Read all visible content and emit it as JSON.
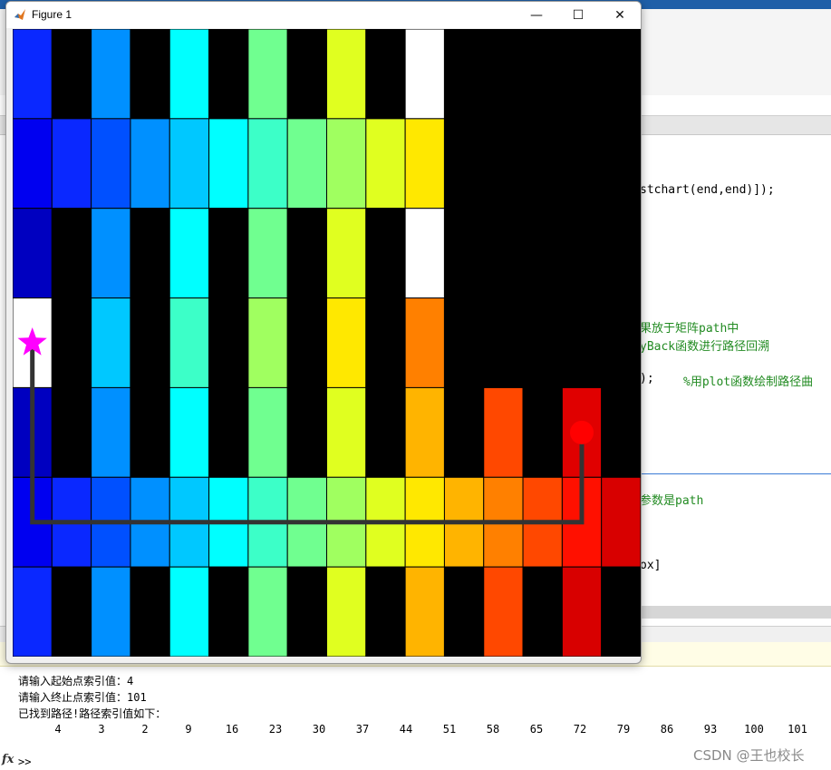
{
  "figure": {
    "title": "Figure 1",
    "controls": {
      "minimize": "—",
      "maximize": "☐",
      "close": "✕"
    }
  },
  "editor": {
    "line1": "stchart(end,end)]);",
    "line2": "果放于矩阵path中",
    "line3": "yBack函数进行路径回溯",
    "line4a": ");",
    "line4b": "%用plot函数绘制路径曲",
    "line5": "参数是path",
    "line6": "ox]"
  },
  "command_window": {
    "line1": "请输入起始点索引值：4",
    "line2": "请输入终止点索引值：101",
    "line3": "已找到路径!路径索引值如下：",
    "path": [
      "4",
      "3",
      "2",
      "9",
      "16",
      "23",
      "30",
      "37",
      "44",
      "51",
      "58",
      "65",
      "72",
      "79",
      "86",
      "93",
      "100",
      "101"
    ],
    "fx": "fx",
    "prompt": ">>"
  },
  "watermark": "CSDN @王也校长",
  "chart_data": {
    "type": "heatmap",
    "colormap": "jet",
    "rows": 7,
    "cols": 16,
    "cells": [
      [
        "#0a28ff",
        "#000000",
        "#0090ff",
        "#000000",
        "#00ffff",
        "#000000",
        "#70ff90",
        "#000000",
        "#e0ff20",
        "#000000",
        "#ffffff",
        "#000000",
        "#000000",
        "#000000",
        "#000000",
        "#000000"
      ],
      [
        "#0000f0",
        "#0a28ff",
        "#0050ff",
        "#0090ff",
        "#00c8ff",
        "#00ffff",
        "#3cffc8",
        "#70ff90",
        "#a0ff60",
        "#e0ff20",
        "#ffe800",
        "#000000",
        "#000000",
        "#000000",
        "#000000",
        "#000000"
      ],
      [
        "#0000c0",
        "#000000",
        "#0090ff",
        "#000000",
        "#00ffff",
        "#000000",
        "#70ff90",
        "#000000",
        "#e0ff20",
        "#000000",
        "#ffffff",
        "#000000",
        "#000000",
        "#000000",
        "#000000",
        "#000000"
      ],
      [
        "#ffffff",
        "#000000",
        "#00c8ff",
        "#000000",
        "#3cffc8",
        "#000000",
        "#a0ff60",
        "#000000",
        "#ffe800",
        "#000000",
        "#ff8000",
        "#000000",
        "#000000",
        "#000000",
        "#000000",
        "#000000"
      ],
      [
        "#0000c0",
        "#000000",
        "#0090ff",
        "#000000",
        "#00ffff",
        "#000000",
        "#70ff90",
        "#000000",
        "#e0ff20",
        "#000000",
        "#ffb400",
        "#000000",
        "#ff4800",
        "#000000",
        "#e00000",
        "#000000"
      ],
      [
        "#0000f0",
        "#0a28ff",
        "#0050ff",
        "#0090ff",
        "#00c8ff",
        "#00ffff",
        "#3cffc8",
        "#70ff90",
        "#a0ff60",
        "#e0ff20",
        "#ffe800",
        "#ffb400",
        "#ff8000",
        "#ff4800",
        "#ff1000",
        "#d80000"
      ],
      [
        "#0a28ff",
        "#000000",
        "#0090ff",
        "#000000",
        "#00ffff",
        "#000000",
        "#70ff90",
        "#000000",
        "#e0ff20",
        "#000000",
        "#ffb400",
        "#000000",
        "#ff4800",
        "#000000",
        "#d80000",
        "#000000"
      ]
    ],
    "path_points": [
      [
        0,
        3
      ],
      [
        0,
        5
      ],
      [
        14,
        5
      ],
      [
        14,
        4
      ]
    ],
    "start": {
      "col": 0,
      "row": 3,
      "marker": "star",
      "color": "#ff00ff"
    },
    "end": {
      "col": 14,
      "row": 4,
      "marker": "circle",
      "color": "#ff0000"
    },
    "path_color": "#333333",
    "grid": true
  }
}
